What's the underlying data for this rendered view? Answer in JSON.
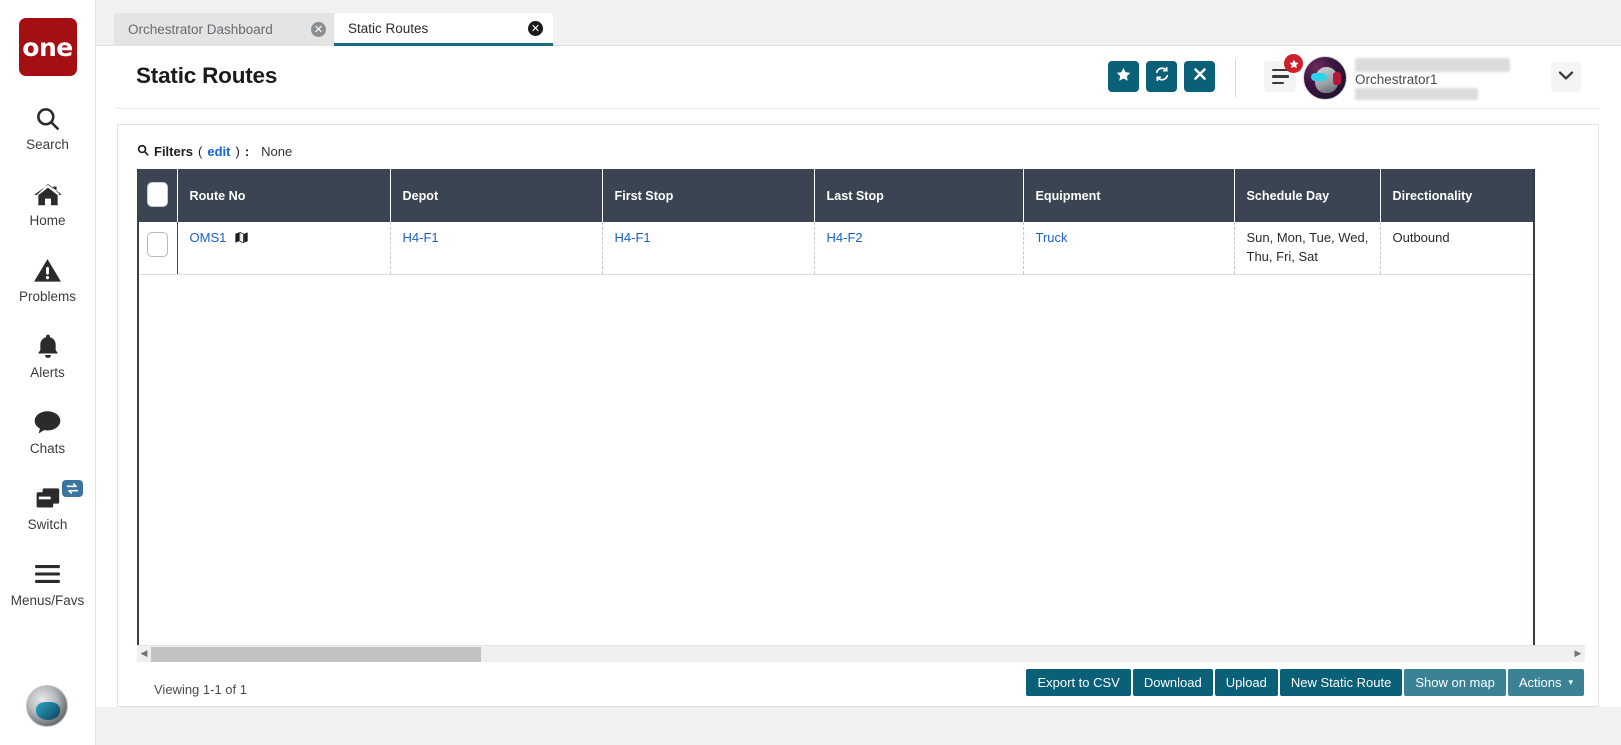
{
  "brand": {
    "logo_text": "one",
    "logo_color": "#a50f14"
  },
  "sidebar": {
    "items": [
      {
        "label": "Search",
        "icon": "search-icon"
      },
      {
        "label": "Home",
        "icon": "home-icon"
      },
      {
        "label": "Problems",
        "icon": "warning-triangle-icon"
      },
      {
        "label": "Alerts",
        "icon": "bell-icon"
      },
      {
        "label": "Chats",
        "icon": "chat-bubble-icon"
      },
      {
        "label": "Switch",
        "icon": "windows-stack-icon",
        "badge_icon": "swap-arrows-icon"
      },
      {
        "label": "Menus/Favs",
        "icon": "hamburger-icon"
      }
    ],
    "avatar_icon": "user-avatar-icon"
  },
  "tabs": [
    {
      "label": "Orchestrator Dashboard",
      "active": false,
      "close_icon": "close-circle-icon"
    },
    {
      "label": "Static Routes",
      "active": true,
      "close_icon": "close-circle-icon"
    }
  ],
  "header": {
    "title": "Static Routes",
    "buttons": [
      {
        "name": "favorite",
        "icon": "star-icon"
      },
      {
        "name": "refresh",
        "icon": "refresh-icon"
      },
      {
        "name": "close",
        "icon": "x-icon"
      }
    ],
    "menu_icon": "menu-lines-icon",
    "menu_badge_icon": "star-badge-icon",
    "user_name": "Orchestrator1",
    "caret_icon": "chevron-down-icon",
    "accent_color": "#0a6077"
  },
  "filters": {
    "icon": "search-icon",
    "label": "Filters",
    "edit_label": "edit",
    "colon": ":",
    "value": "None",
    "link_color": "#1565d8"
  },
  "table": {
    "columns": [
      "Route No",
      "Depot",
      "First Stop",
      "Last Stop",
      "Equipment",
      "Schedule Day",
      "Directionality"
    ],
    "header_bg": "#3a4453",
    "rows": [
      {
        "route_no": "OMS1",
        "route_no_icon": "map-icon",
        "depot": "H4-F1",
        "first_stop": "H4-F1",
        "last_stop": "H4-F2",
        "equipment": "Truck",
        "schedule_day": "Sun, Mon, Tue, Wed, Thu, Fri, Sat",
        "directionality": "Outbound"
      }
    ]
  },
  "scrollbar": {
    "left_arrow": "◀",
    "right_arrow": "▶"
  },
  "footer": {
    "viewing_text": "Viewing 1-1 of 1",
    "buttons": [
      {
        "label": "Export to CSV",
        "style": "dark"
      },
      {
        "label": "Download",
        "style": "dark"
      },
      {
        "label": "Upload",
        "style": "dark"
      },
      {
        "label": "New Static Route",
        "style": "dark"
      },
      {
        "label": "Show on map",
        "style": "light"
      },
      {
        "label": "Actions",
        "style": "light",
        "caret": "▾"
      }
    ]
  }
}
